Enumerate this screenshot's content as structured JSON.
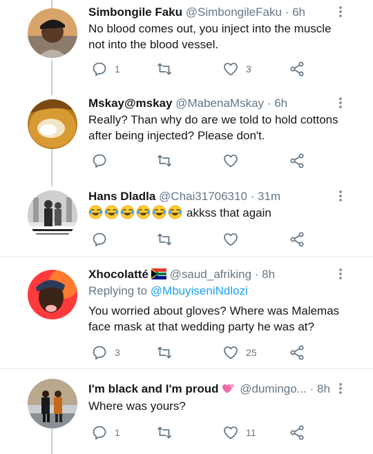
{
  "tweets": [
    {
      "display_name": "Simbongile Faku",
      "handle": "@SimbongileFaku",
      "time": "6h",
      "text": "No blood comes out, you inject into the muscle not into the blood vessel.",
      "reply_count": "1",
      "retweet_count": "",
      "like_count": "3"
    },
    {
      "display_name": "Mskay@mskay",
      "handle": "@MabenaMskay",
      "time": "6h",
      "text": "Really? Than why do are we told to hold cottons after being injected? Please don't.",
      "reply_count": "",
      "retweet_count": "",
      "like_count": ""
    },
    {
      "display_name": "Hans Dladla",
      "handle": "@Chai31706310",
      "time": "31m",
      "emoji_name": "face-with-tears-of-joy",
      "text": "akkss that again",
      "reply_count": "",
      "retweet_count": "",
      "like_count": ""
    },
    {
      "display_name": "Xhocolatté",
      "flag": "south-africa-flag",
      "handle": "@saud_afriking",
      "time": "8h",
      "replying_prefix": "Replying to",
      "replying_to": "@MbuyiseniNdlozi",
      "text": "You worried about gloves? Where was Malemas face mask at that wedding party he was at?",
      "reply_count": "3",
      "retweet_count": "",
      "like_count": "25"
    },
    {
      "display_name": "I'm black and I'm proud",
      "name_emoji": "two-hearts",
      "handle": "@dumingo...",
      "time": "8h",
      "text": "Where was yours?",
      "reply_count": "1",
      "retweet_count": "",
      "like_count": "11"
    }
  ],
  "separator": "·",
  "colors": {
    "text": "#14171a",
    "secondary": "#657786",
    "link": "#1da1f2",
    "icon": "#657786",
    "thread_line": "#c4cfd6",
    "divider": "#e1e8ed"
  }
}
